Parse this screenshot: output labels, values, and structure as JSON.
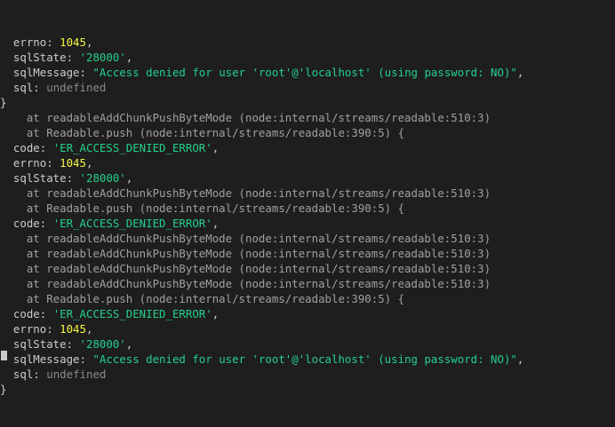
{
  "terminal": {
    "lines": [
      {
        "indent": "  ",
        "parts": [
          {
            "t": "errno: ",
            "c": "key"
          },
          {
            "t": "1045",
            "c": "num"
          },
          {
            "t": ",",
            "c": "key"
          }
        ]
      },
      {
        "indent": "  ",
        "parts": [
          {
            "t": "sqlState: ",
            "c": "key"
          },
          {
            "t": "'28000'",
            "c": "str"
          },
          {
            "t": ",",
            "c": "key"
          }
        ]
      },
      {
        "indent": "  ",
        "parts": [
          {
            "t": "sqlMessage: ",
            "c": "key"
          },
          {
            "t": "\"Access denied for user 'root'@'localhost' (using password: NO)\"",
            "c": "str"
          },
          {
            "t": ",",
            "c": "key"
          }
        ]
      },
      {
        "indent": "  ",
        "parts": [
          {
            "t": "sql: ",
            "c": "key"
          },
          {
            "t": "undefined",
            "c": "und"
          }
        ]
      },
      {
        "indent": "",
        "parts": [
          {
            "t": "}",
            "c": "key"
          }
        ]
      },
      {
        "indent": "    ",
        "parts": [
          {
            "t": "at readableAddChunkPushByteMode (node:internal/streams/readable:510:3)",
            "c": "trace"
          }
        ]
      },
      {
        "indent": "    ",
        "parts": [
          {
            "t": "at Readable.push (node:internal/streams/readable:390:5) {",
            "c": "trace"
          }
        ]
      },
      {
        "indent": "  ",
        "parts": [
          {
            "t": "code: ",
            "c": "key"
          },
          {
            "t": "'ER_ACCESS_DENIED_ERROR'",
            "c": "str"
          },
          {
            "t": ",",
            "c": "key"
          }
        ]
      },
      {
        "indent": "  ",
        "parts": [
          {
            "t": "errno: ",
            "c": "key"
          },
          {
            "t": "1045",
            "c": "num"
          },
          {
            "t": ",",
            "c": "key"
          }
        ]
      },
      {
        "indent": "  ",
        "parts": [
          {
            "t": "sqlState: ",
            "c": "key"
          },
          {
            "t": "'28000'",
            "c": "str"
          },
          {
            "t": ",",
            "c": "key"
          }
        ]
      },
      {
        "indent": "    ",
        "parts": [
          {
            "t": "at readableAddChunkPushByteMode (node:internal/streams/readable:510:3)",
            "c": "trace"
          }
        ]
      },
      {
        "indent": "    ",
        "parts": [
          {
            "t": "at Readable.push (node:internal/streams/readable:390:5) {",
            "c": "trace"
          }
        ]
      },
      {
        "indent": "  ",
        "parts": [
          {
            "t": "code: ",
            "c": "key"
          },
          {
            "t": "'ER_ACCESS_DENIED_ERROR'",
            "c": "str"
          },
          {
            "t": ",",
            "c": "key"
          }
        ]
      },
      {
        "indent": "    ",
        "parts": [
          {
            "t": "at readableAddChunkPushByteMode (node:internal/streams/readable:510:3)",
            "c": "trace"
          }
        ]
      },
      {
        "indent": "    ",
        "parts": [
          {
            "t": "at readableAddChunkPushByteMode (node:internal/streams/readable:510:3)",
            "c": "trace"
          }
        ]
      },
      {
        "indent": "    ",
        "parts": [
          {
            "t": "at readableAddChunkPushByteMode (node:internal/streams/readable:510:3)",
            "c": "trace"
          }
        ]
      },
      {
        "indent": "    ",
        "parts": [
          {
            "t": "at readableAddChunkPushByteMode (node:internal/streams/readable:510:3)",
            "c": "trace"
          }
        ]
      },
      {
        "indent": "    ",
        "parts": [
          {
            "t": "at Readable.push (node:internal/streams/readable:390:5) {",
            "c": "trace"
          }
        ]
      },
      {
        "indent": "  ",
        "parts": [
          {
            "t": "code: ",
            "c": "key"
          },
          {
            "t": "'ER_ACCESS_DENIED_ERROR'",
            "c": "str"
          },
          {
            "t": ",",
            "c": "key"
          }
        ]
      },
      {
        "indent": "  ",
        "parts": [
          {
            "t": "errno: ",
            "c": "key"
          },
          {
            "t": "1045",
            "c": "num"
          },
          {
            "t": ",",
            "c": "key"
          }
        ]
      },
      {
        "indent": "  ",
        "parts": [
          {
            "t": "sqlState: ",
            "c": "key"
          },
          {
            "t": "'28000'",
            "c": "str"
          },
          {
            "t": ",",
            "c": "key"
          }
        ]
      },
      {
        "indent": "  ",
        "parts": [
          {
            "t": "sqlMessage: ",
            "c": "key"
          },
          {
            "t": "\"Access denied for user 'root'@'localhost' (using password: NO)\"",
            "c": "str"
          },
          {
            "t": ",",
            "c": "key"
          }
        ]
      },
      {
        "indent": "  ",
        "parts": [
          {
            "t": "sql: ",
            "c": "key"
          },
          {
            "t": "undefined",
            "c": "und"
          }
        ]
      },
      {
        "indent": "",
        "parts": [
          {
            "t": "}",
            "c": "key"
          }
        ]
      }
    ]
  },
  "colors": {
    "background": "#1e1e1e",
    "text": "#cccccc",
    "number": "#f5f543",
    "string": "#23d18b",
    "undefined": "#8a8a8a",
    "trace": "#a0a0a0"
  }
}
